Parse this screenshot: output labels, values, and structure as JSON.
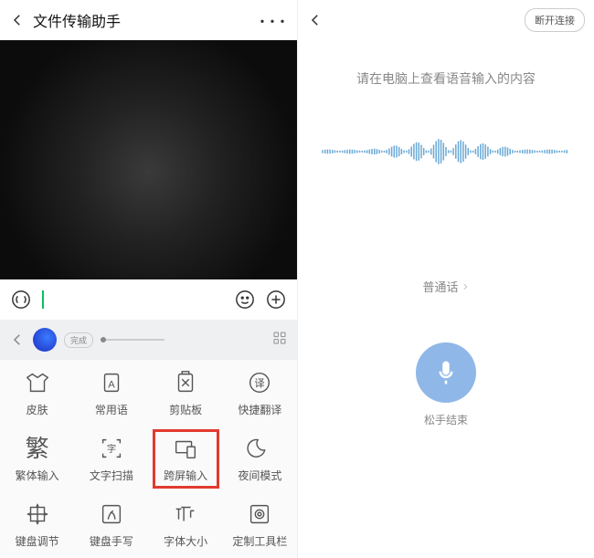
{
  "left": {
    "title": "文件传输助手",
    "input_placeholder": "",
    "kb_topbar": {
      "pill": "完成"
    },
    "tools": [
      {
        "name": "skin",
        "label": "皮肤"
      },
      {
        "name": "phrases",
        "label": "常用语"
      },
      {
        "name": "clipboard",
        "label": "剪贴板"
      },
      {
        "name": "translate",
        "label": "快捷翻译"
      },
      {
        "name": "trad",
        "label": "繁体输入"
      },
      {
        "name": "ocr",
        "label": "文字扫描"
      },
      {
        "name": "cross",
        "label": "跨屏输入"
      },
      {
        "name": "night",
        "label": "夜间模式"
      },
      {
        "name": "resize",
        "label": "键盘调节"
      },
      {
        "name": "handwrite",
        "label": "键盘手写"
      },
      {
        "name": "fontsize",
        "label": "字体大小"
      },
      {
        "name": "custom",
        "label": "定制工具栏"
      }
    ]
  },
  "right": {
    "disconnect": "断开连接",
    "hint": "请在电脑上查看语音输入的内容",
    "language": "普通话",
    "mic_label": "松手结束"
  }
}
